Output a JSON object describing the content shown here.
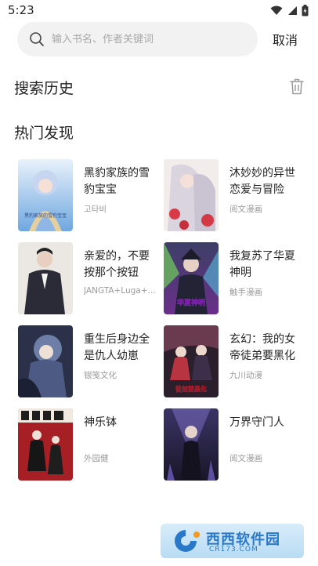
{
  "status_bar": {
    "time": "5:23"
  },
  "search": {
    "placeholder": "输入书名、作者关键词",
    "value": "",
    "cancel_label": "取消"
  },
  "history": {
    "title": "搜索历史"
  },
  "discover": {
    "title": "热门发现",
    "books": [
      {
        "title_line1": "黑豹家族的雪",
        "title_line2": "豹宝宝",
        "author": "고타비",
        "cover_text": "黑豹家族的雪豹宝宝"
      },
      {
        "title_line1": "沐妙妙的异世",
        "title_line2": "恋爱与冒险",
        "author": "阅文漫画",
        "cover_text": ""
      },
      {
        "title_line1": "亲爱的，不要",
        "title_line2": "按那个按钮",
        "author": "JANGTA+Luga+…",
        "cover_text": ""
      },
      {
        "title_line1": "我复苏了华夏",
        "title_line2": "神明",
        "author": "触手漫画",
        "cover_text": "华夏神明"
      },
      {
        "title_line1": "重生后身边全",
        "title_line2": "是仇人幼崽",
        "author": "银笺文化",
        "cover_text": ""
      },
      {
        "title_line1": "玄幻：我的女",
        "title_line2": "帝徒弟要黑化",
        "author": "九川动漫",
        "cover_text": "徒弟要黑化"
      },
      {
        "title_line1": "神乐钵",
        "title_line2": "",
        "author": "外园健",
        "cover_text": ""
      },
      {
        "title_line1": "万界守门人",
        "title_line2": "",
        "author": "阅文漫画",
        "cover_text": ""
      }
    ]
  },
  "watermark": {
    "text": "西西软件园",
    "sub": "CR173.COM"
  }
}
